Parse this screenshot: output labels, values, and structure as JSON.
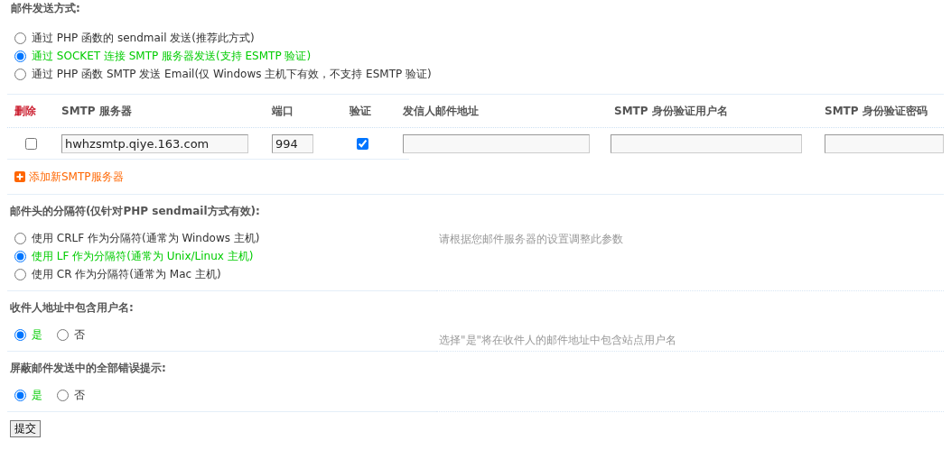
{
  "send_method": {
    "heading": "邮件发送方式:",
    "options": [
      {
        "label": "通过 PHP 函数的 sendmail 发送(推荐此方式)",
        "selected": false
      },
      {
        "label": "通过 SOCKET 连接 SMTP 服务器发送(支持 ESMTP 验证)",
        "selected": true
      },
      {
        "label": "通过 PHP 函数 SMTP 发送 Email(仅 Windows 主机下有效，不支持 ESMTP 验证)",
        "selected": false
      }
    ]
  },
  "smtp_table": {
    "columns": [
      "删除",
      "SMTP 服务器",
      "端口",
      "验证",
      "发信人邮件地址",
      "SMTP 身份验证用户名",
      "SMTP 身份验证密码"
    ],
    "rows": [
      {
        "delete": false,
        "server": "hwhzsmtp.qiye.163.com",
        "port": "994",
        "auth": true
      }
    ],
    "add_link": "添加新SMTP服务器"
  },
  "sections": [
    {
      "heading": "邮件头的分隔符(仅针对PHP sendmail方式有效):",
      "hint": "请根据您邮件服务器的设置调整此参数",
      "kind": "column",
      "options": [
        {
          "label": "使用 CRLF 作为分隔符(通常为 Windows 主机)",
          "selected": false
        },
        {
          "label": "使用 LF 作为分隔符(通常为 Unix/Linux 主机)",
          "selected": true
        },
        {
          "label": "使用 CR 作为分隔符(通常为 Mac 主机)",
          "selected": false
        }
      ]
    },
    {
      "heading": "收件人地址中包含用户名:",
      "hint": "选择\"是\"将在收件人的邮件地址中包含站点用户名",
      "kind": "row",
      "options": [
        {
          "label": "是",
          "selected": true
        },
        {
          "label": "否",
          "selected": false
        }
      ]
    },
    {
      "heading": "屏蔽邮件发送中的全部错误提示:",
      "kind": "row",
      "options": [
        {
          "label": "是",
          "selected": true
        },
        {
          "label": "否",
          "selected": false
        }
      ]
    }
  ],
  "submit": "提交"
}
